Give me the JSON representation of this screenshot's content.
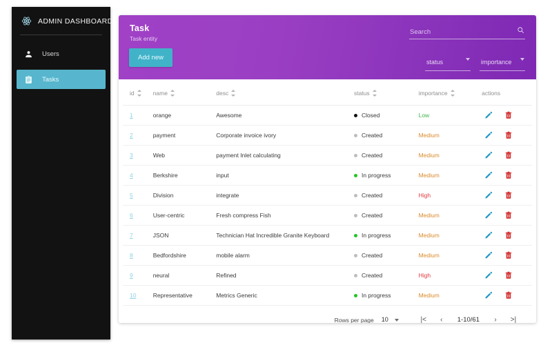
{
  "sidebar": {
    "brand": {
      "title": "ADMIN DASHBOARD",
      "logo_icon": "react-atom-icon"
    },
    "items": [
      {
        "label": "Users",
        "icon": "user-icon",
        "active": false
      },
      {
        "label": "Tasks",
        "icon": "clipboard-icon",
        "active": true
      }
    ]
  },
  "header": {
    "title": "Task",
    "subtitle": "Task entity",
    "add_button": "Add new",
    "search": {
      "value": "",
      "placeholder": "Search",
      "icon": "search-icon"
    },
    "filters": [
      {
        "label": "status",
        "icon": "chevron-down-icon"
      },
      {
        "label": "importance",
        "icon": "chevron-down-icon"
      }
    ]
  },
  "table": {
    "columns": [
      {
        "key": "id",
        "label": "id",
        "sortable": true
      },
      {
        "key": "name",
        "label": "name",
        "sortable": true
      },
      {
        "key": "desc",
        "label": "desc",
        "sortable": true
      },
      {
        "key": "status",
        "label": "status",
        "sortable": true
      },
      {
        "key": "importance",
        "label": "importance",
        "sortable": true
      },
      {
        "key": "actions",
        "label": "actions",
        "sortable": false
      }
    ],
    "rows": [
      {
        "id": "1",
        "name": "orange",
        "desc": "Awesome",
        "status": "Closed",
        "status_kind": "closed",
        "importance": "Low"
      },
      {
        "id": "2",
        "name": "payment",
        "desc": "Corporate invoice ivory",
        "status": "Created",
        "status_kind": "created",
        "importance": "Medium"
      },
      {
        "id": "3",
        "name": "Web",
        "desc": "payment Inlet calculating",
        "status": "Created",
        "status_kind": "created",
        "importance": "Medium"
      },
      {
        "id": "4",
        "name": "Berkshire",
        "desc": "input",
        "status": "In progress",
        "status_kind": "inprogress",
        "importance": "Medium"
      },
      {
        "id": "5",
        "name": "Division",
        "desc": "integrate",
        "status": "Created",
        "status_kind": "created",
        "importance": "High"
      },
      {
        "id": "6",
        "name": "User-centric",
        "desc": "Fresh compress Fish",
        "status": "Created",
        "status_kind": "created",
        "importance": "Medium"
      },
      {
        "id": "7",
        "name": "JSON",
        "desc": "Technician Hat Incredible Granite Keyboard",
        "status": "In progress",
        "status_kind": "inprogress",
        "importance": "Medium"
      },
      {
        "id": "8",
        "name": "Bedfordshire",
        "desc": "mobile alarm",
        "status": "Created",
        "status_kind": "created",
        "importance": "Medium"
      },
      {
        "id": "9",
        "name": "neural",
        "desc": "Refined",
        "status": "Created",
        "status_kind": "created",
        "importance": "High"
      },
      {
        "id": "10",
        "name": "Representative",
        "desc": "Metrics Generic",
        "status": "In progress",
        "status_kind": "inprogress",
        "importance": "Medium"
      }
    ],
    "row_actions": [
      {
        "name": "edit-row-button",
        "icon": "pencil-icon"
      },
      {
        "name": "delete-row-button",
        "icon": "trash-icon"
      }
    ]
  },
  "footer": {
    "rows_per_page_label": "Rows per page",
    "rows_per_page_value": "10",
    "range": "1-10/61",
    "first_label": "|<",
    "prev_label": "‹",
    "next_label": "›",
    "last_label": ">|"
  },
  "colors": {
    "sidebar_bg": "#121212",
    "accent_teal": "#41b3c9",
    "header_purple_start": "#a041c6",
    "header_purple_end": "#7e28b4",
    "importance_low": "#3cb54a",
    "importance_medium": "#d98a2b",
    "importance_high": "#e0393e",
    "delete_red": "#d32f2f",
    "edit_blue": "#2196c4"
  }
}
